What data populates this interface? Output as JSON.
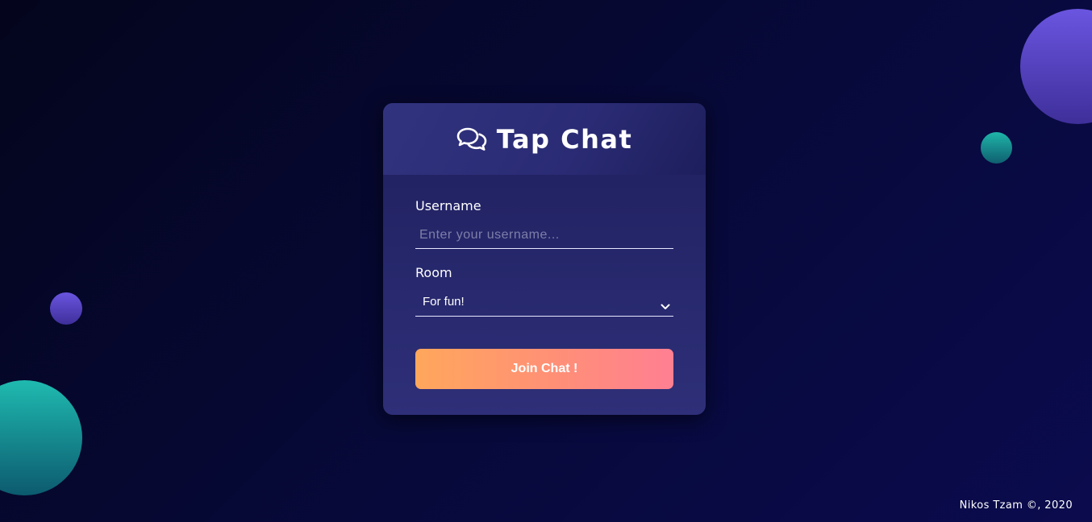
{
  "app": {
    "title": "Tap Chat",
    "icon": "comments-icon"
  },
  "form": {
    "username_label": "Username",
    "username_placeholder": "Enter your username...",
    "username_value": "",
    "room_label": "Room",
    "room_selected": "For fun!",
    "join_button_label": "Join Chat !"
  },
  "footer": {
    "credit": "Nikos Tzam ©, 2020"
  },
  "colors": {
    "background": "#05061f",
    "card": "#2a2b72",
    "accent_start": "#ffa75c",
    "accent_end": "#ff7f92",
    "bubble_purple": "#6a55e0",
    "bubble_teal": "#1fb5aa"
  }
}
